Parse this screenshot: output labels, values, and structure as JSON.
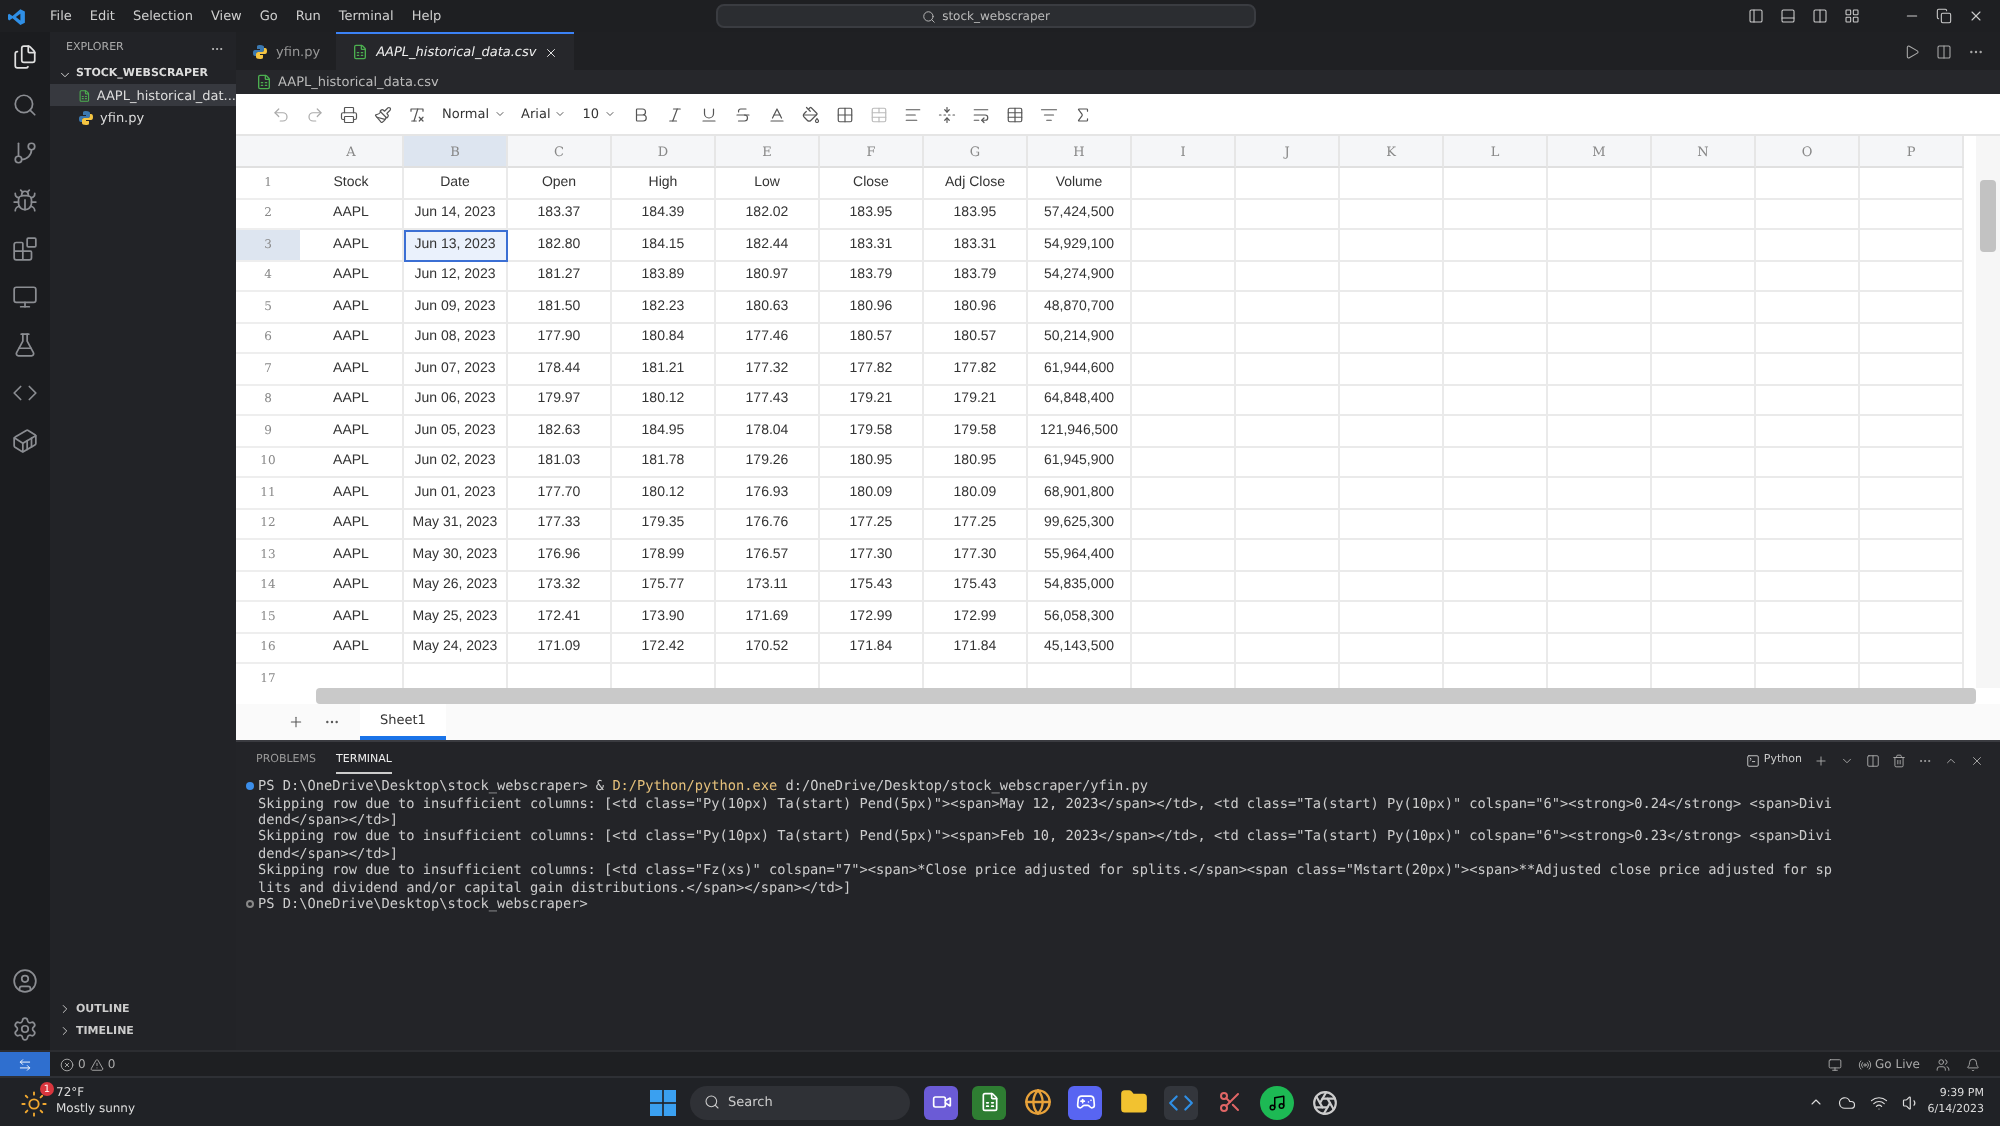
{
  "title_bar": {
    "menu": [
      "File",
      "Edit",
      "Selection",
      "View",
      "Go",
      "Run",
      "Terminal",
      "Help"
    ],
    "search": "stock_webscraper"
  },
  "sidebar": {
    "title": "EXPLORER",
    "folder": {
      "name": "STOCK_WEBSCRAPER",
      "expanded": true,
      "children": [
        {
          "name": "AAPL_historical_dat...",
          "kind": "csv",
          "selected": true
        },
        {
          "name": "yfin.py",
          "kind": "python",
          "selected": false
        }
      ]
    },
    "sections": [
      {
        "name": "OUTLINE",
        "expanded": false
      },
      {
        "name": "TIMELINE",
        "expanded": false
      }
    ]
  },
  "editor_tabs": [
    {
      "label": "yfin.py",
      "kind": "python",
      "selected": false
    },
    {
      "label": "AAPL_historical_data.csv",
      "kind": "csv",
      "selected": true
    }
  ],
  "breadcrumb": {
    "label": "AAPL_historical_data.csv",
    "kind": "csv"
  },
  "sheet": {
    "toolbar": {
      "style": "Normal",
      "font": "Arial",
      "size": "10"
    },
    "columns": [
      {
        "label": "A",
        "selected": false
      },
      {
        "label": "B",
        "selected": true
      },
      {
        "label": "C",
        "selected": false
      },
      {
        "label": "D",
        "selected": false
      },
      {
        "label": "E",
        "selected": false
      },
      {
        "label": "F",
        "selected": false
      },
      {
        "label": "G",
        "selected": false
      },
      {
        "label": "H",
        "selected": false
      },
      {
        "label": "I",
        "selected": false
      },
      {
        "label": "J",
        "selected": false
      },
      {
        "label": "K",
        "selected": false
      },
      {
        "label": "L",
        "selected": false
      },
      {
        "label": "M",
        "selected": false
      },
      {
        "label": "N",
        "selected": false
      },
      {
        "label": "O",
        "selected": false
      },
      {
        "label": "P",
        "selected": false
      }
    ],
    "rows": [
      {
        "number": "1",
        "selected": false,
        "cells": [
          "Stock",
          "Date",
          "Open",
          "High",
          "Low",
          "Close",
          "Adj Close",
          "Volume"
        ]
      },
      {
        "number": "2",
        "selected": false,
        "cells": [
          "AAPL",
          "Jun 14, 2023",
          "183.37",
          "184.39",
          "182.02",
          "183.95",
          "183.95",
          "57,424,500"
        ]
      },
      {
        "number": "3",
        "selected": true,
        "cells": [
          "AAPL",
          "Jun 13, 2023",
          "182.80",
          "184.15",
          "182.44",
          "183.31",
          "183.31",
          "54,929,100"
        ]
      },
      {
        "number": "4",
        "selected": false,
        "cells": [
          "AAPL",
          "Jun 12, 2023",
          "181.27",
          "183.89",
          "180.97",
          "183.79",
          "183.79",
          "54,274,900"
        ]
      },
      {
        "number": "5",
        "selected": false,
        "cells": [
          "AAPL",
          "Jun 09, 2023",
          "181.50",
          "182.23",
          "180.63",
          "180.96",
          "180.96",
          "48,870,700"
        ]
      },
      {
        "number": "6",
        "selected": false,
        "cells": [
          "AAPL",
          "Jun 08, 2023",
          "177.90",
          "180.84",
          "177.46",
          "180.57",
          "180.57",
          "50,214,900"
        ]
      },
      {
        "number": "7",
        "selected": false,
        "cells": [
          "AAPL",
          "Jun 07, 2023",
          "178.44",
          "181.21",
          "177.32",
          "177.82",
          "177.82",
          "61,944,600"
        ]
      },
      {
        "number": "8",
        "selected": false,
        "cells": [
          "AAPL",
          "Jun 06, 2023",
          "179.97",
          "180.12",
          "177.43",
          "179.21",
          "179.21",
          "64,848,400"
        ]
      },
      {
        "number": "9",
        "selected": false,
        "cells": [
          "AAPL",
          "Jun 05, 2023",
          "182.63",
          "184.95",
          "178.04",
          "179.58",
          "179.58",
          "121,946,500"
        ]
      },
      {
        "number": "10",
        "selected": false,
        "cells": [
          "AAPL",
          "Jun 02, 2023",
          "181.03",
          "181.78",
          "179.26",
          "180.95",
          "180.95",
          "61,945,900"
        ]
      },
      {
        "number": "11",
        "selected": false,
        "cells": [
          "AAPL",
          "Jun 01, 2023",
          "177.70",
          "180.12",
          "176.93",
          "180.09",
          "180.09",
          "68,901,800"
        ]
      },
      {
        "number": "12",
        "selected": false,
        "cells": [
          "AAPL",
          "May 31, 2023",
          "177.33",
          "179.35",
          "176.76",
          "177.25",
          "177.25",
          "99,625,300"
        ]
      },
      {
        "number": "13",
        "selected": false,
        "cells": [
          "AAPL",
          "May 30, 2023",
          "176.96",
          "178.99",
          "176.57",
          "177.30",
          "177.30",
          "55,964,400"
        ]
      },
      {
        "number": "14",
        "selected": false,
        "cells": [
          "AAPL",
          "May 26, 2023",
          "173.32",
          "175.77",
          "173.11",
          "175.43",
          "175.43",
          "54,835,000"
        ]
      },
      {
        "number": "15",
        "selected": false,
        "cells": [
          "AAPL",
          "May 25, 2023",
          "172.41",
          "173.90",
          "171.69",
          "172.99",
          "172.99",
          "56,058,300"
        ]
      },
      {
        "number": "16",
        "selected": false,
        "cells": [
          "AAPL",
          "May 24, 2023",
          "171.09",
          "172.42",
          "170.52",
          "171.84",
          "171.84",
          "45,143,500"
        ]
      }
    ],
    "cut_row_number": "17",
    "sheet_tabs": [
      {
        "label": "Sheet1",
        "selected": true
      }
    ]
  },
  "panel": {
    "tabs": [
      {
        "label": "PROBLEMS",
        "selected": false
      },
      {
        "label": "TERMINAL",
        "selected": true
      }
    ],
    "shell": "Python",
    "lines": [
      {
        "kind": "command",
        "prompt": "PS D:\\OneDrive\\Desktop\\stock_webscraper> & ",
        "program": "D:/Python/python.exe",
        "args": " d:/OneDrive/Desktop/stock_webscraper/yfin.py"
      },
      {
        "kind": "output",
        "text": "Skipping row due to insufficient columns: [<td class=\"Py(10px) Ta(start) Pend(5px)\"><span>May 12, 2023</span></td>, <td class=\"Ta(start) Py(10px)\" colspan=\"6\"><strong>0.24</strong> <span>Divi"
      },
      {
        "kind": "output",
        "text": "dend</span></td>]"
      },
      {
        "kind": "output",
        "text": "Skipping row due to insufficient columns: [<td class=\"Py(10px) Ta(start) Pend(5px)\"><span>Feb 10, 2023</span></td>, <td class=\"Ta(start) Py(10px)\" colspan=\"6\"><strong>0.23</strong> <span>Divi"
      },
      {
        "kind": "output",
        "text": "dend</span></td>]"
      },
      {
        "kind": "output",
        "text": "Skipping row due to insufficient columns: [<td class=\"Fz(xs)\" colspan=\"7\"><span>*Close price adjusted for splits.</span><span class=\"Mstart(20px)\"><span>**Adjusted close price adjusted for sp"
      },
      {
        "kind": "output",
        "text": "lits and dividend and/or capital gain distributions.</span></span></td>]"
      },
      {
        "kind": "prompt",
        "prompt": "PS D:\\OneDrive\\Desktop\\stock_webscraper> "
      }
    ]
  },
  "status_bar": {
    "errors": "0",
    "warnings": "0",
    "go_live": "Go Live"
  },
  "taskbar": {
    "weather": {
      "temperature": "72°F",
      "condition": "Mostly sunny",
      "badge": "1"
    },
    "search": "Search",
    "time": "9:39 PM",
    "date": "6/14/2023"
  }
}
